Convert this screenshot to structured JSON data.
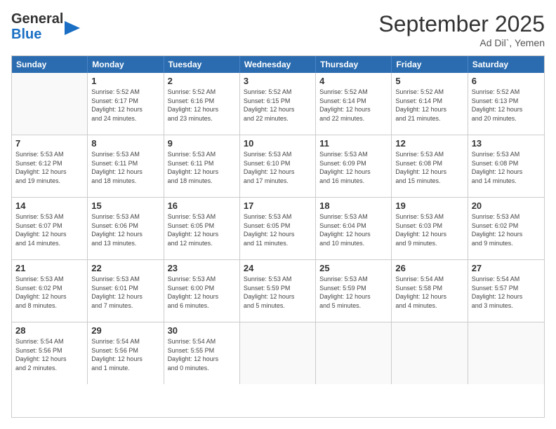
{
  "header": {
    "logo_line1": "General",
    "logo_line2": "Blue",
    "month": "September 2025",
    "location": "Ad Dil`, Yemen"
  },
  "days_of_week": [
    "Sunday",
    "Monday",
    "Tuesday",
    "Wednesday",
    "Thursday",
    "Friday",
    "Saturday"
  ],
  "weeks": [
    [
      {
        "day": "",
        "info": ""
      },
      {
        "day": "1",
        "info": "Sunrise: 5:52 AM\nSunset: 6:17 PM\nDaylight: 12 hours\nand 24 minutes."
      },
      {
        "day": "2",
        "info": "Sunrise: 5:52 AM\nSunset: 6:16 PM\nDaylight: 12 hours\nand 23 minutes."
      },
      {
        "day": "3",
        "info": "Sunrise: 5:52 AM\nSunset: 6:15 PM\nDaylight: 12 hours\nand 22 minutes."
      },
      {
        "day": "4",
        "info": "Sunrise: 5:52 AM\nSunset: 6:14 PM\nDaylight: 12 hours\nand 22 minutes."
      },
      {
        "day": "5",
        "info": "Sunrise: 5:52 AM\nSunset: 6:14 PM\nDaylight: 12 hours\nand 21 minutes."
      },
      {
        "day": "6",
        "info": "Sunrise: 5:52 AM\nSunset: 6:13 PM\nDaylight: 12 hours\nand 20 minutes."
      }
    ],
    [
      {
        "day": "7",
        "info": "Sunrise: 5:53 AM\nSunset: 6:12 PM\nDaylight: 12 hours\nand 19 minutes."
      },
      {
        "day": "8",
        "info": "Sunrise: 5:53 AM\nSunset: 6:11 PM\nDaylight: 12 hours\nand 18 minutes."
      },
      {
        "day": "9",
        "info": "Sunrise: 5:53 AM\nSunset: 6:11 PM\nDaylight: 12 hours\nand 18 minutes."
      },
      {
        "day": "10",
        "info": "Sunrise: 5:53 AM\nSunset: 6:10 PM\nDaylight: 12 hours\nand 17 minutes."
      },
      {
        "day": "11",
        "info": "Sunrise: 5:53 AM\nSunset: 6:09 PM\nDaylight: 12 hours\nand 16 minutes."
      },
      {
        "day": "12",
        "info": "Sunrise: 5:53 AM\nSunset: 6:08 PM\nDaylight: 12 hours\nand 15 minutes."
      },
      {
        "day": "13",
        "info": "Sunrise: 5:53 AM\nSunset: 6:08 PM\nDaylight: 12 hours\nand 14 minutes."
      }
    ],
    [
      {
        "day": "14",
        "info": "Sunrise: 5:53 AM\nSunset: 6:07 PM\nDaylight: 12 hours\nand 14 minutes."
      },
      {
        "day": "15",
        "info": "Sunrise: 5:53 AM\nSunset: 6:06 PM\nDaylight: 12 hours\nand 13 minutes."
      },
      {
        "day": "16",
        "info": "Sunrise: 5:53 AM\nSunset: 6:05 PM\nDaylight: 12 hours\nand 12 minutes."
      },
      {
        "day": "17",
        "info": "Sunrise: 5:53 AM\nSunset: 6:05 PM\nDaylight: 12 hours\nand 11 minutes."
      },
      {
        "day": "18",
        "info": "Sunrise: 5:53 AM\nSunset: 6:04 PM\nDaylight: 12 hours\nand 10 minutes."
      },
      {
        "day": "19",
        "info": "Sunrise: 5:53 AM\nSunset: 6:03 PM\nDaylight: 12 hours\nand 9 minutes."
      },
      {
        "day": "20",
        "info": "Sunrise: 5:53 AM\nSunset: 6:02 PM\nDaylight: 12 hours\nand 9 minutes."
      }
    ],
    [
      {
        "day": "21",
        "info": "Sunrise: 5:53 AM\nSunset: 6:02 PM\nDaylight: 12 hours\nand 8 minutes."
      },
      {
        "day": "22",
        "info": "Sunrise: 5:53 AM\nSunset: 6:01 PM\nDaylight: 12 hours\nand 7 minutes."
      },
      {
        "day": "23",
        "info": "Sunrise: 5:53 AM\nSunset: 6:00 PM\nDaylight: 12 hours\nand 6 minutes."
      },
      {
        "day": "24",
        "info": "Sunrise: 5:53 AM\nSunset: 5:59 PM\nDaylight: 12 hours\nand 5 minutes."
      },
      {
        "day": "25",
        "info": "Sunrise: 5:53 AM\nSunset: 5:59 PM\nDaylight: 12 hours\nand 5 minutes."
      },
      {
        "day": "26",
        "info": "Sunrise: 5:54 AM\nSunset: 5:58 PM\nDaylight: 12 hours\nand 4 minutes."
      },
      {
        "day": "27",
        "info": "Sunrise: 5:54 AM\nSunset: 5:57 PM\nDaylight: 12 hours\nand 3 minutes."
      }
    ],
    [
      {
        "day": "28",
        "info": "Sunrise: 5:54 AM\nSunset: 5:56 PM\nDaylight: 12 hours\nand 2 minutes."
      },
      {
        "day": "29",
        "info": "Sunrise: 5:54 AM\nSunset: 5:56 PM\nDaylight: 12 hours\nand 1 minute."
      },
      {
        "day": "30",
        "info": "Sunrise: 5:54 AM\nSunset: 5:55 PM\nDaylight: 12 hours\nand 0 minutes."
      },
      {
        "day": "",
        "info": ""
      },
      {
        "day": "",
        "info": ""
      },
      {
        "day": "",
        "info": ""
      },
      {
        "day": "",
        "info": ""
      }
    ]
  ]
}
